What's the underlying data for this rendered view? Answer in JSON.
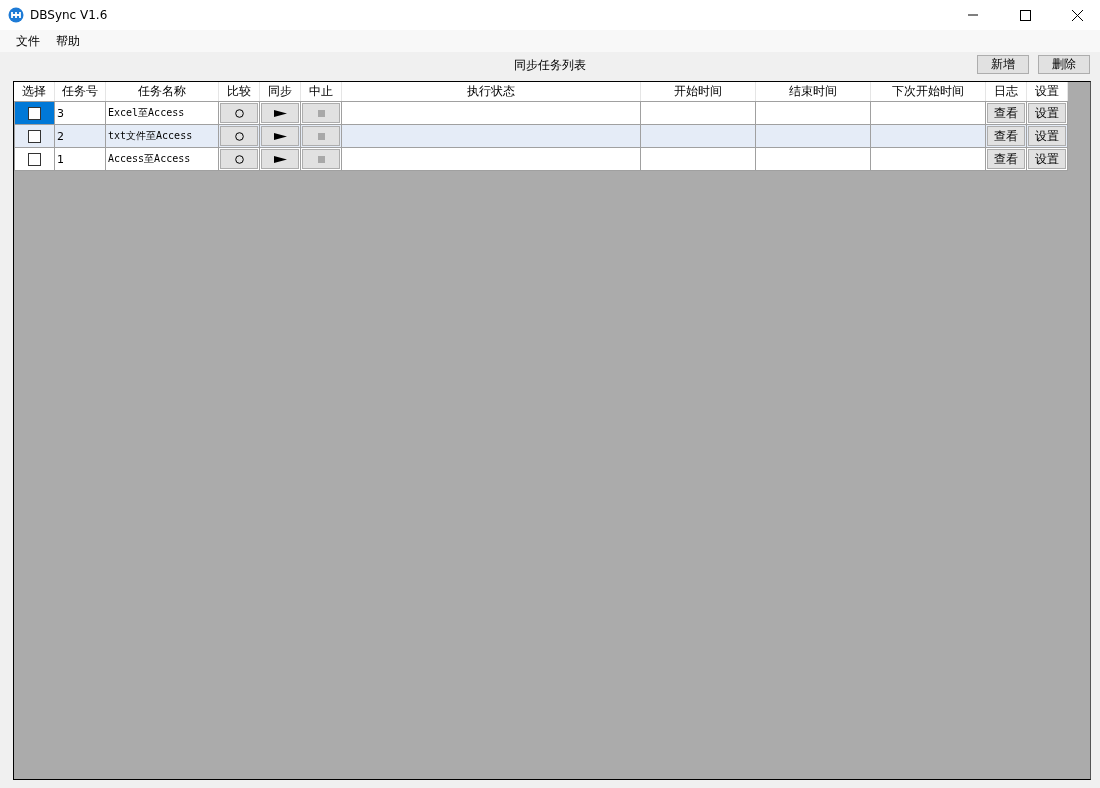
{
  "window": {
    "title": "DBSync V1.6"
  },
  "menu": [
    "文件",
    "帮助"
  ],
  "toolbar": {
    "title": "同步任务列表",
    "buttons": [
      "新增",
      "删除"
    ]
  },
  "table": {
    "columns": [
      "选择",
      "任务号",
      "任务名称",
      "比较",
      "同步",
      "中止",
      "执行状态",
      "开始时间",
      "结束时间",
      "下次开始时间",
      "日志",
      "设置"
    ],
    "rows": [
      {
        "selected": true,
        "checked": false,
        "id": "3",
        "name": "Excel至Access",
        "stop_disabled": true,
        "status": "",
        "log": "查看",
        "settings": "设置"
      },
      {
        "selected": false,
        "checked": false,
        "id": "2",
        "name": "txt文件至Access",
        "stop_disabled": true,
        "status": "",
        "log": "查看",
        "settings": "设置"
      },
      {
        "selected": false,
        "checked": false,
        "id": "1",
        "name": "Access至Access",
        "stop_disabled": true,
        "status": "",
        "log": "查看",
        "settings": "设置"
      }
    ]
  }
}
